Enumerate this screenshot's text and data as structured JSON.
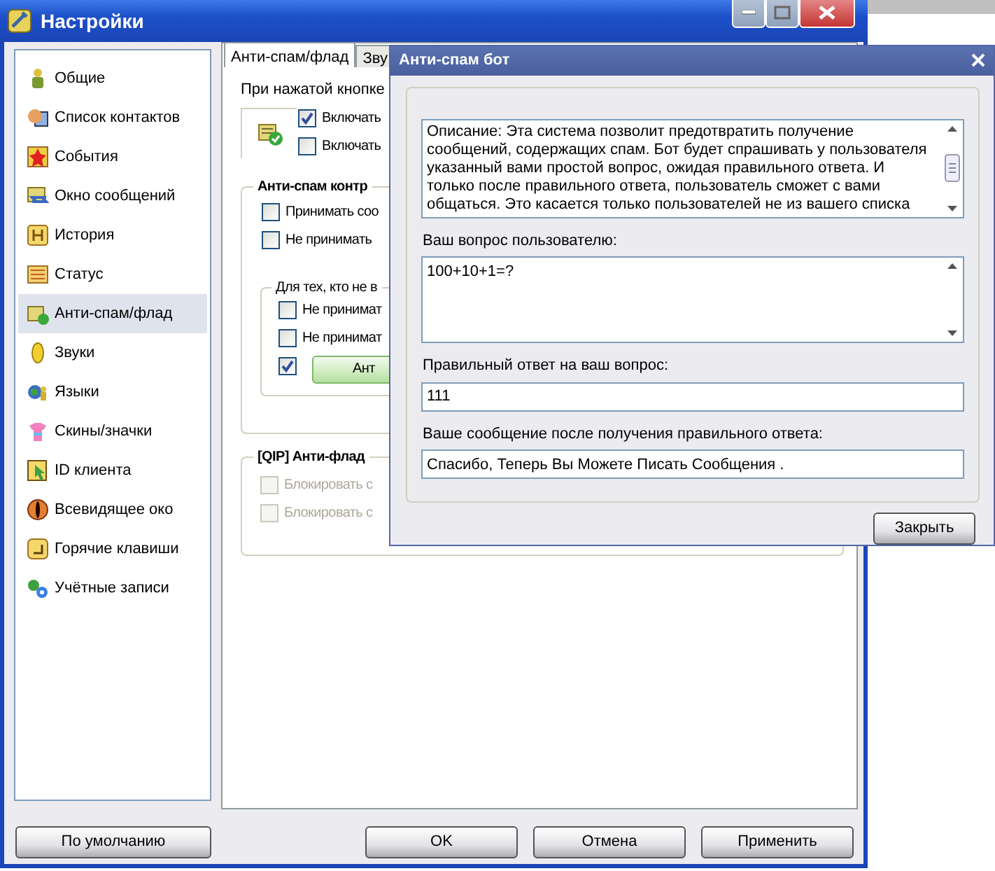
{
  "window": {
    "title": "Настройки"
  },
  "sidebar": {
    "items": [
      {
        "label": "Общие",
        "selected": false
      },
      {
        "label": "Список контактов",
        "selected": false
      },
      {
        "label": "События",
        "selected": false
      },
      {
        "label": "Окно сообщений",
        "selected": false
      },
      {
        "label": "История",
        "selected": false
      },
      {
        "label": "Статус",
        "selected": false
      },
      {
        "label": "Анти-спам/флад",
        "selected": true
      },
      {
        "label": "Звуки",
        "selected": false
      },
      {
        "label": "Языки",
        "selected": false
      },
      {
        "label": "Скины/значки",
        "selected": false
      },
      {
        "label": "ID клиента",
        "selected": false
      },
      {
        "label": "Всевидящее око",
        "selected": false
      },
      {
        "label": "Горячие клавиши",
        "selected": false
      },
      {
        "label": "Учётные записи",
        "selected": false
      }
    ]
  },
  "tabs": [
    {
      "label": "Анти-спам/флад",
      "selected": true
    },
    {
      "label": "Зву",
      "selected": false
    }
  ],
  "hotkey_section": {
    "label": "При нажатой кнопке",
    "options": [
      {
        "label": "Включать",
        "checked": true
      },
      {
        "label": "Включать",
        "checked": false
      }
    ]
  },
  "antispam_group": {
    "title": "Анти-спам контр",
    "options": [
      {
        "label": "Принимать соо",
        "checked": false
      },
      {
        "label": "Не принимать",
        "checked": false
      }
    ],
    "subgroup": {
      "title": "Для тех, кто не в",
      "options": [
        {
          "label": "Не принимат",
          "checked": false
        },
        {
          "label": "Не принимат",
          "checked": false
        }
      ],
      "bot": {
        "checked": true,
        "button": "Ант"
      }
    }
  },
  "qip_group": {
    "title": "[QIP] Анти-флад",
    "options": [
      {
        "label": "Блокировать с",
        "checked": false,
        "disabled": true
      },
      {
        "label": "Блокировать с",
        "checked": false,
        "disabled": true
      }
    ]
  },
  "footer": {
    "default_button": "По умолчанию",
    "buttons": [
      "OK",
      "Отмена",
      "Применить"
    ]
  },
  "dialog": {
    "title": "Анти-спам бот",
    "description": "Описание: Эта система позволит предотвратить получение сообщений, содержащих спам. Бот будет спрашивать у пользователя указанный вами простой вопрос, ожидая правильного ответа. И только после правильного ответа, пользователь сможет с вами общаться. Это касается только пользователей не из вашего списка",
    "fields": [
      {
        "kind": "multiline",
        "label": "Ваш вопрос пользователю:",
        "value": "100+10+1=?"
      },
      {
        "kind": "line",
        "label": "Правильный ответ на ваш вопрос:",
        "value": "111"
      },
      {
        "kind": "line",
        "label": "Ваше сообщение после получения правильного ответа:",
        "value": "Спасибо, Теперь Вы Можете Писать Сообщения ."
      }
    ],
    "close_button": "Закрыть"
  }
}
